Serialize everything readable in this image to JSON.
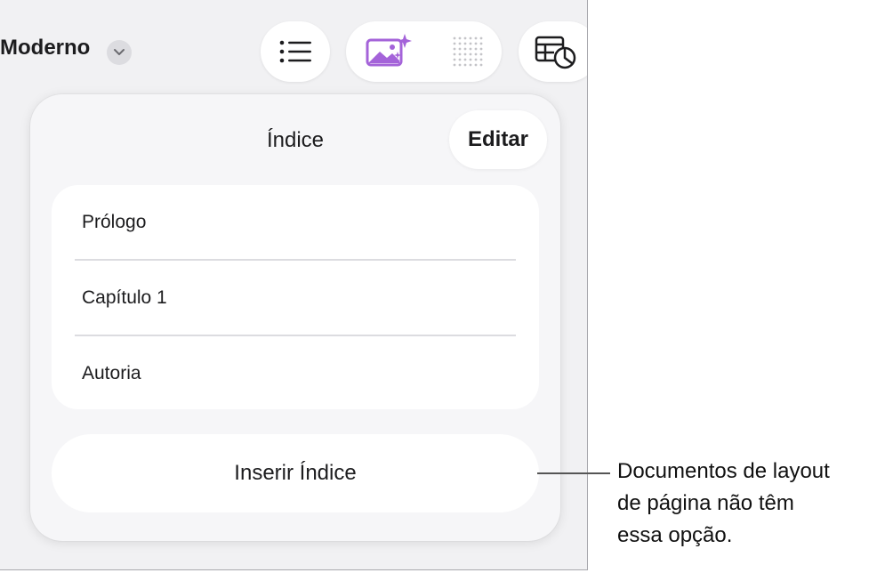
{
  "toolbar": {
    "style_name": "Moderno",
    "icons": [
      "chevron-down-icon",
      "list-icon",
      "image-sparkle-icon",
      "dot-grid-icon",
      "table-chart-icon"
    ]
  },
  "popover": {
    "title": "Índice",
    "edit_label": "Editar",
    "items": [
      {
        "label": "Prólogo"
      },
      {
        "label": "Capítulo 1"
      },
      {
        "label": "Autoria"
      }
    ],
    "insert_label": "Inserir Índice"
  },
  "callout": {
    "lines": [
      "Documentos de layout",
      "de página não têm",
      "essa opção."
    ]
  },
  "colors": {
    "accent_purple": "#a463d9",
    "background": "#f1f1f3",
    "panel": "#ffffff"
  }
}
